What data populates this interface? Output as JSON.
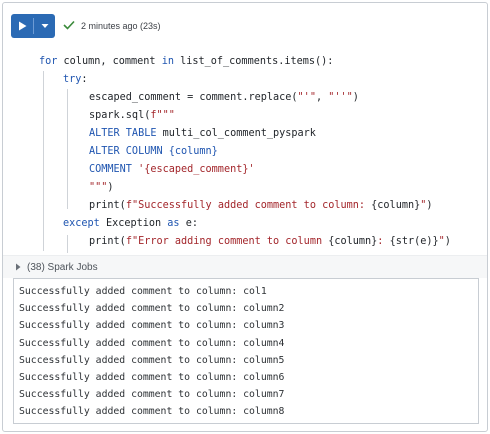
{
  "toolbar": {
    "run_button_label": "Run cell",
    "status_text": "2 minutes ago (23s)",
    "colors": {
      "run_button": "#2b6ab4",
      "success_check": "#3a8a3a"
    }
  },
  "code": {
    "lines": [
      {
        "id": "l1",
        "parts": [
          {
            "t": "for",
            "c": "kw"
          },
          {
            "t": " column, comment ",
            "c": ""
          },
          {
            "t": "in",
            "c": "kw"
          },
          {
            "t": " list_of_comments.items():",
            "c": ""
          }
        ]
      },
      {
        "id": "l2",
        "parts": [
          {
            "t": "try",
            "c": "kw"
          },
          {
            "t": ":",
            "c": ""
          }
        ]
      },
      {
        "id": "l3",
        "parts": [
          {
            "t": "escaped_comment = comment.replace(",
            "c": ""
          },
          {
            "t": "\"'\"",
            "c": "str"
          },
          {
            "t": ", ",
            "c": ""
          },
          {
            "t": "\"''\"",
            "c": "str"
          },
          {
            "t": ")",
            "c": ""
          }
        ]
      },
      {
        "id": "l4",
        "parts": [
          {
            "t": "spark.sql(",
            "c": ""
          },
          {
            "t": "f\"\"\"",
            "c": "str"
          }
        ]
      },
      {
        "id": "l5",
        "parts": [
          {
            "t": "ALTER TABLE",
            "c": "kw"
          },
          {
            "t": " multi_col_comment_pyspark",
            "c": ""
          }
        ]
      },
      {
        "id": "l6",
        "parts": [
          {
            "t": "ALTER COLUMN",
            "c": "kw"
          },
          {
            "t": " ",
            "c": ""
          },
          {
            "t": "{column}",
            "c": "kw"
          }
        ]
      },
      {
        "id": "l7",
        "parts": [
          {
            "t": "COMMENT",
            "c": "kw"
          },
          {
            "t": " ",
            "c": ""
          },
          {
            "t": "'{escaped_comment}'",
            "c": "str"
          }
        ]
      },
      {
        "id": "l8",
        "parts": [
          {
            "t": "\"\"\"",
            "c": "str"
          },
          {
            "t": ")",
            "c": ""
          }
        ]
      },
      {
        "id": "l9",
        "parts": [
          {
            "t": "print(",
            "c": ""
          },
          {
            "t": "f\"Successfully added comment to column: ",
            "c": "str"
          },
          {
            "t": "{column}",
            "c": ""
          },
          {
            "t": "\"",
            "c": "str"
          },
          {
            "t": ")",
            "c": ""
          }
        ]
      },
      {
        "id": "l10",
        "parts": [
          {
            "t": "except",
            "c": "kw"
          },
          {
            "t": " Exception ",
            "c": ""
          },
          {
            "t": "as",
            "c": "kw"
          },
          {
            "t": " e:",
            "c": ""
          }
        ]
      },
      {
        "id": "l11",
        "parts": [
          {
            "t": "print(",
            "c": ""
          },
          {
            "t": "f\"Error adding comment to column ",
            "c": "str"
          },
          {
            "t": "{column}",
            "c": ""
          },
          {
            "t": ": ",
            "c": "str"
          },
          {
            "t": "{str(e)}",
            "c": ""
          },
          {
            "t": "\"",
            "c": "str"
          },
          {
            "t": ")",
            "c": ""
          }
        ]
      }
    ]
  },
  "spark_jobs": {
    "label": "(38) Spark Jobs"
  },
  "output": {
    "lines": [
      "Successfully added comment to column: col1",
      "Successfully added comment to column: column2",
      "Successfully added comment to column: column3",
      "Successfully added comment to column: column4",
      "Successfully added comment to column: column5",
      "Successfully added comment to column: column6",
      "Successfully added comment to column: column7",
      "Successfully added comment to column: column8"
    ]
  }
}
